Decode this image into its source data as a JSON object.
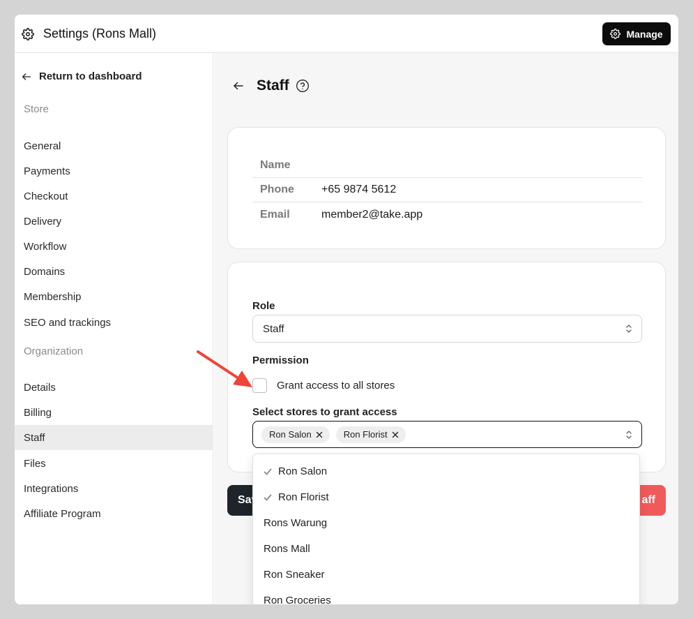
{
  "header": {
    "title": "Settings (Rons Mall)",
    "manage_label": "Manage"
  },
  "sidebar": {
    "back_label": "Return to dashboard",
    "store_section": "Store",
    "store_items": [
      "General",
      "Payments",
      "Checkout",
      "Delivery",
      "Workflow",
      "Domains",
      "Membership",
      "SEO and trackings"
    ],
    "org_section": "Organization",
    "org_items": [
      "Details",
      "Billing",
      "Staff",
      "Files",
      "Integrations",
      "Affiliate Program"
    ],
    "active_item": "Staff"
  },
  "page": {
    "title": "Staff",
    "info": [
      {
        "label": "Name",
        "value": ""
      },
      {
        "label": "Phone",
        "value": "+65 9874 5612"
      },
      {
        "label": "Email",
        "value": "member2@take.app"
      }
    ],
    "role_label": "Role",
    "role_value": "Staff",
    "permission_label": "Permission",
    "grant_all_label": "Grant access to all stores",
    "select_stores_label": "Select stores to grant access",
    "selected_stores": [
      "Ron Salon",
      "Ron Florist"
    ],
    "save_label": "Sav",
    "remove_label": "aff"
  },
  "dropdown": {
    "options": [
      {
        "label": "Ron Salon",
        "selected": true
      },
      {
        "label": "Ron Florist",
        "selected": true
      },
      {
        "label": "Rons Warung",
        "selected": false
      },
      {
        "label": "Rons Mall",
        "selected": false
      },
      {
        "label": "Ron Sneaker",
        "selected": false
      },
      {
        "label": "Ron Groceries",
        "selected": false
      }
    ]
  },
  "colors": {
    "accent_dark": "#0c0c0c",
    "danger": "#f15a5a",
    "annotation_arrow": "#ef4438"
  },
  "icons": {
    "settings": "gear-icon",
    "back": "arrow-left-icon",
    "help": "question-circle-icon",
    "select": "chevron-up-down-icon",
    "remove_chip": "close-icon",
    "selected": "check-icon"
  }
}
